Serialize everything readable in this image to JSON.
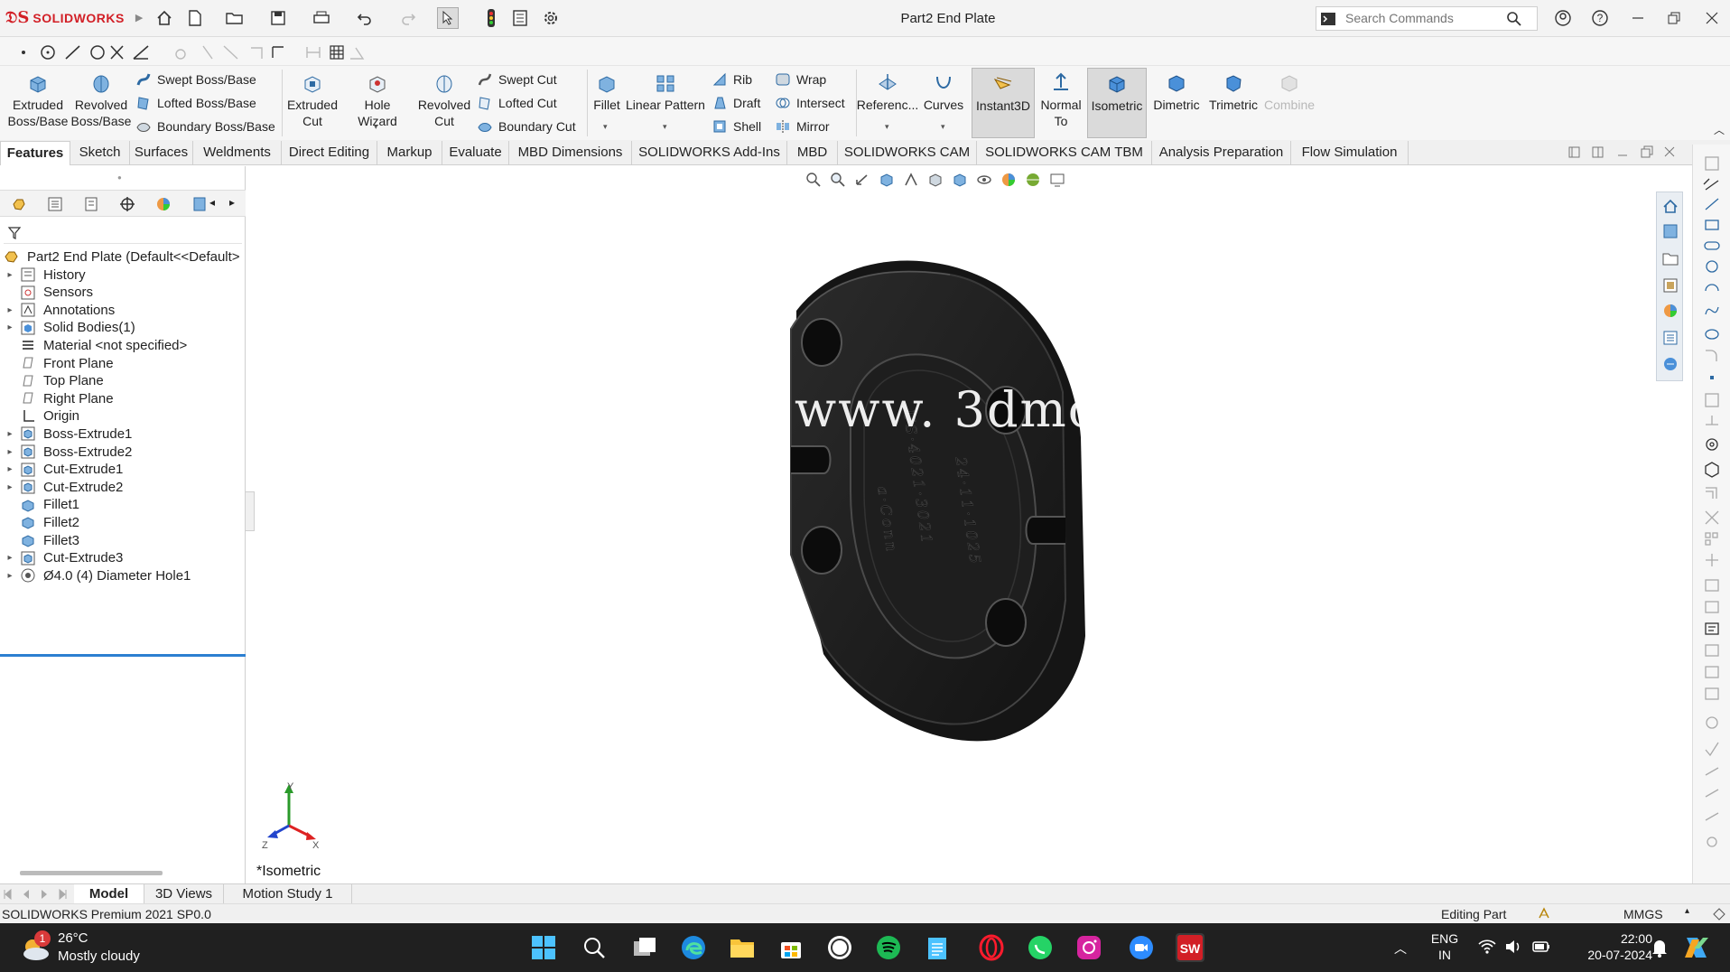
{
  "titlebar": {
    "brand": "SOLIDWORKS",
    "document_title": "Part2 End Plate",
    "search_placeholder": "Search Commands"
  },
  "ribbon": {
    "extruded_boss": "Extruded Boss/Base",
    "revolved_boss": "Revolved Boss/Base",
    "swept_boss": "Swept Boss/Base",
    "lofted_boss": "Lofted Boss/Base",
    "boundary_boss": "Boundary Boss/Base",
    "extruded_cut": "Extruded Cut",
    "hole_wizard": "Hole Wizard",
    "revolved_cut": "Revolved Cut",
    "swept_cut": "Swept Cut",
    "lofted_cut": "Lofted Cut",
    "boundary_cut": "Boundary Cut",
    "fillet": "Fillet",
    "linear_pattern": "Linear Pattern",
    "rib": "Rib",
    "draft": "Draft",
    "shell": "Shell",
    "wrap": "Wrap",
    "intersect": "Intersect",
    "mirror": "Mirror",
    "reference": "Referenc...",
    "curves": "Curves",
    "instant3d": "Instant3D",
    "normal_to": "Normal To",
    "isometric": "Isometric",
    "dimetric": "Dimetric",
    "trimetric": "Trimetric",
    "combine": "Combine"
  },
  "tabs": [
    "Features",
    "Sketch",
    "Surfaces",
    "Weldments",
    "Direct Editing",
    "Markup",
    "Evaluate",
    "MBD Dimensions",
    "SOLIDWORKS Add-Ins",
    "MBD",
    "SOLIDWORKS CAM",
    "SOLIDWORKS CAM TBM",
    "Analysis Preparation",
    "Flow Simulation"
  ],
  "tree": {
    "root": "Part2 End Plate  (Default<<Default>",
    "items": [
      {
        "label": "History"
      },
      {
        "label": "Sensors"
      },
      {
        "label": "Annotations"
      },
      {
        "label": "Solid Bodies(1)"
      },
      {
        "label": "Material <not specified>"
      },
      {
        "label": "Front Plane"
      },
      {
        "label": "Top Plane"
      },
      {
        "label": "Right Plane"
      },
      {
        "label": "Origin"
      },
      {
        "label": "Boss-Extrude1"
      },
      {
        "label": "Boss-Extrude2"
      },
      {
        "label": "Cut-Extrude1"
      },
      {
        "label": "Cut-Extrude2"
      },
      {
        "label": "Fillet1"
      },
      {
        "label": "Fillet2"
      },
      {
        "label": "Fillet3"
      },
      {
        "label": "Cut-Extrude3"
      },
      {
        "label": "Ø4.0 (4) Diameter Hole1"
      }
    ]
  },
  "graphics": {
    "watermark": "www. 3dmox. co",
    "view_label": "*Isometric",
    "triad": {
      "x": "X",
      "y": "Y",
      "z": "Z"
    }
  },
  "bottom_tabs": [
    "Model",
    "3D Views",
    "Motion Study 1"
  ],
  "status": {
    "version": "SOLIDWORKS Premium 2021 SP0.0",
    "mode": "Editing Part",
    "units": "MMGS"
  },
  "taskbar": {
    "weather_temp": "26°C",
    "weather_desc": "Mostly cloudy",
    "notification_count": "1",
    "lang_line1": "ENG",
    "lang_line2": "IN",
    "time": "22:00",
    "date": "20-07-2024"
  },
  "colors": {
    "brand_red": "#d21f26",
    "part_body": "#1c1c1c",
    "tree_selection": "#2c7fd1",
    "taskbar": "#202020"
  }
}
